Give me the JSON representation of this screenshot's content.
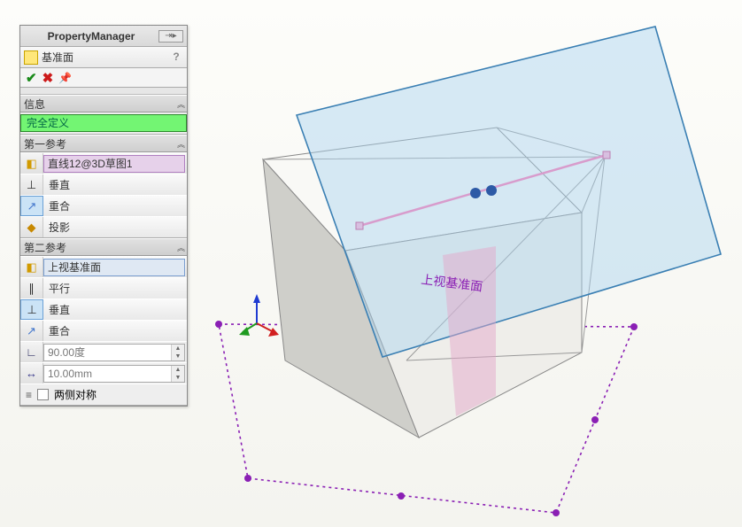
{
  "panel": {
    "title": "PropertyManager",
    "feature_name": "基准面",
    "help": "?"
  },
  "info_section": {
    "label": "信息",
    "status": "完全定义"
  },
  "ref1": {
    "label": "第一参考",
    "selection": "直线12@3D草图1",
    "constraints": {
      "perpendicular": "垂直",
      "coincident": "重合",
      "project": "投影"
    }
  },
  "ref2": {
    "label": "第二参考",
    "selection": "上视基准面",
    "constraints": {
      "parallel": "平行",
      "perpendicular": "垂直",
      "coincident": "重合"
    },
    "angle_value": "90.00度",
    "distance_value": "10.00mm",
    "symmetric_label": "两侧对称"
  },
  "viewport": {
    "plane_label": "上视基准面"
  }
}
